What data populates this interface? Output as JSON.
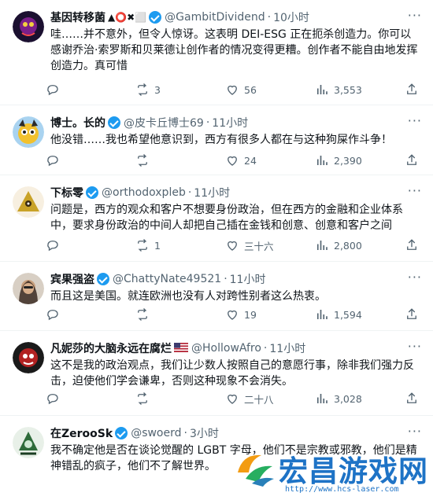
{
  "tweets": [
    {
      "name": "基因转移菌",
      "name_emoji": "▲⭕✖⬜",
      "verified": true,
      "handle": "@GambitDividend",
      "time": "10小时",
      "text": "哇……并不意外，但令人惊讶。这表明 DEI-ESG 正在扼杀创造力。你可以感谢乔治·索罗斯和贝莱德让创作者的情况变得更糟。创作者不能自由地发挥创造力。真可惜",
      "reply": "",
      "retweet": "3",
      "like": "56",
      "views": "3,553",
      "avatar_color": "#2a1a3a"
    },
    {
      "name": "博士。长的",
      "name_emoji": "",
      "verified": true,
      "handle": "@皮卡丘博士69",
      "time": "11小时",
      "text": "他没错……我也希望他意识到，西方有很多人都在与这种狗屎作斗争！",
      "reply": "",
      "retweet": "",
      "like": "24",
      "views": "2,390",
      "avatar_color": "#e7b53b"
    },
    {
      "name": "下标零",
      "name_emoji": "",
      "verified": true,
      "handle": "@orthodoxpleb",
      "time": "11小时",
      "text": "问题是，西方的观众和客户不想要身份政治，但在西方的金融和企业体系中，要求身份政治的中间人却把自己插在金钱和创意、创意和客户之间",
      "reply": "",
      "retweet": "1",
      "like": "三十六",
      "views": "2,800",
      "avatar_color": "#3a2a10"
    },
    {
      "name": "宾果强盗",
      "name_emoji": "",
      "verified": true,
      "handle": "@ChattyNate49521",
      "time": "11小时",
      "text": "而且这是美国。就连欧洲也没有人对跨性别者这么热衷。",
      "reply": "",
      "retweet": "",
      "like": "19",
      "views": "1,594",
      "avatar_color": "#6b5a4e"
    },
    {
      "name": "凡妮莎的大脑永远在腐烂",
      "name_emoji": "🇺🇸",
      "verified": false,
      "handle": "@HollowAfro",
      "time": "11小时",
      "text": "这不是我的政治观点，我们让少数人按照自己的意愿行事，除非我们强力反击，迫使他们学会谦卑，否则这种现象不会消失。",
      "reply": "",
      "retweet": "",
      "like": "二十八",
      "views": "3,028",
      "avatar_color": "#8c1c1c"
    },
    {
      "name": "在ZerooSk",
      "name_emoji": "",
      "verified": true,
      "handle": "@swoerd",
      "time": "3小时",
      "text": "我不确定他是否在谈论觉醒的 LGBT 字母，他们不是宗教或邪教，他们是精神错乱的疯子，他们不了解世界。",
      "reply": "",
      "retweet": "",
      "like": "",
      "views": "",
      "avatar_color": "#2e6b3a"
    }
  ],
  "watermark": {
    "title": "宏昌游戏网",
    "url": "http://www.hcs-laser.com"
  }
}
